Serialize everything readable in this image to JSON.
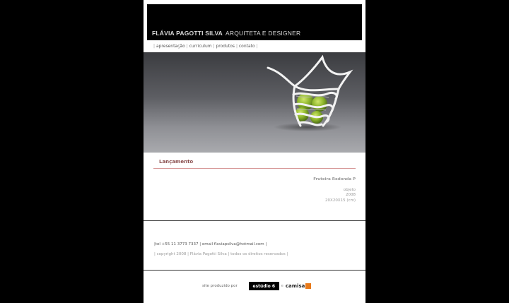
{
  "header": {
    "name": "FLÁVIA PAGOTTI SILVA",
    "role": "ARQUITETA E DESIGNER"
  },
  "nav": {
    "items": [
      "apresentação",
      "curriculum",
      "produtos",
      "contato"
    ]
  },
  "section": {
    "title": "Lançamento"
  },
  "product": {
    "name": "Fruteira Redonda P",
    "type": "objeto",
    "year": "2008",
    "dimensions": "20X20X15 (cm)"
  },
  "footer": {
    "contact": "|tel +55 11 3773 7337 | email flaviapsilva@hotmail.com |",
    "copyright": "| copyright 2008 | Flávia Pagotti Silva | todos os direitos reservados |",
    "produced_by": "site produzido por",
    "studio": "estúdio 6",
    "connector": "e",
    "partner": "camisa"
  },
  "colors": {
    "accent_line": "#d89a9a",
    "title": "#8a4e4e",
    "partner_mark": "#e87a1a"
  }
}
